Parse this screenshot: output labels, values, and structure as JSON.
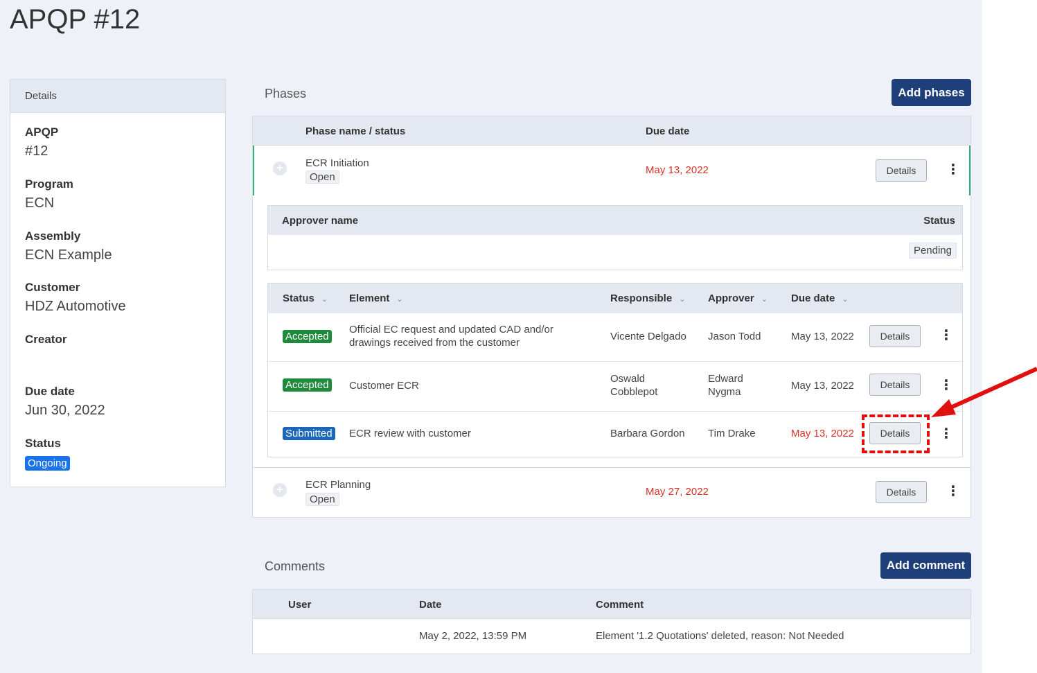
{
  "page": {
    "title": "APQP #12"
  },
  "details": {
    "header": "Details",
    "fields": [
      {
        "label": "APQP",
        "value": "#12"
      },
      {
        "label": "Program",
        "value": "ECN"
      },
      {
        "label": "Assembly",
        "value": "ECN Example"
      },
      {
        "label": "Customer",
        "value": "HDZ Automotive"
      },
      {
        "label": "Creator",
        "value": ""
      },
      {
        "label": "Due date",
        "value": "Jun 30, 2022"
      },
      {
        "label": "Status",
        "value": "Ongoing"
      }
    ]
  },
  "phases": {
    "title": "Phases",
    "add_label": "Add phases",
    "columns": {
      "name": "Phase name / status",
      "due": "Due date"
    },
    "rows": [
      {
        "name": "ECR Initiation",
        "status": "Open",
        "due": "May 13, 2022",
        "details": "Details"
      },
      {
        "name": "ECR Planning",
        "status": "Open",
        "due": "May 27, 2022",
        "details": "Details"
      }
    ],
    "approver": {
      "columns": {
        "name": "Approver name",
        "status": "Status"
      },
      "status": "Pending"
    },
    "elements": {
      "columns": {
        "status": "Status",
        "element": "Element",
        "responsible": "Responsible",
        "approver": "Approver",
        "due": "Due date"
      },
      "rows": [
        {
          "status": "Accepted",
          "element": "Official EC request and updated CAD and/or drawings received from the customer",
          "responsible": "Vicente Delgado",
          "approver": "Jason Todd",
          "due": "May 13, 2022",
          "details": "Details"
        },
        {
          "status": "Accepted",
          "element": "Customer ECR",
          "responsible": "Oswald Cobblepot",
          "approver": "Edward Nygma",
          "due": "May 13, 2022",
          "details": "Details"
        },
        {
          "status": "Submitted",
          "element": "ECR review with customer",
          "responsible": "Barbara Gordon",
          "approver": "Tim Drake",
          "due": "May 13, 2022",
          "details": "Details"
        }
      ]
    }
  },
  "comments": {
    "title": "Comments",
    "add_label": "Add comment",
    "columns": {
      "user": "User",
      "date": "Date",
      "comment": "Comment"
    },
    "rows": [
      {
        "user": "",
        "date": "May 2, 2022, 13:59 PM",
        "comment": "Element '1.2 Quotations' deleted, reason: Not Needed"
      }
    ]
  },
  "colors": {
    "accent": "#1e3f7a",
    "overdue": "#d93025",
    "accepted": "#1f8a3b",
    "submitted": "#1c66b8",
    "ongoing": "#1a73e8",
    "annotation": "#e01010"
  },
  "icons": {
    "expand": "plus-circle-icon",
    "more": "kebab-menu-icon",
    "sort": "chevron-down-icon"
  }
}
